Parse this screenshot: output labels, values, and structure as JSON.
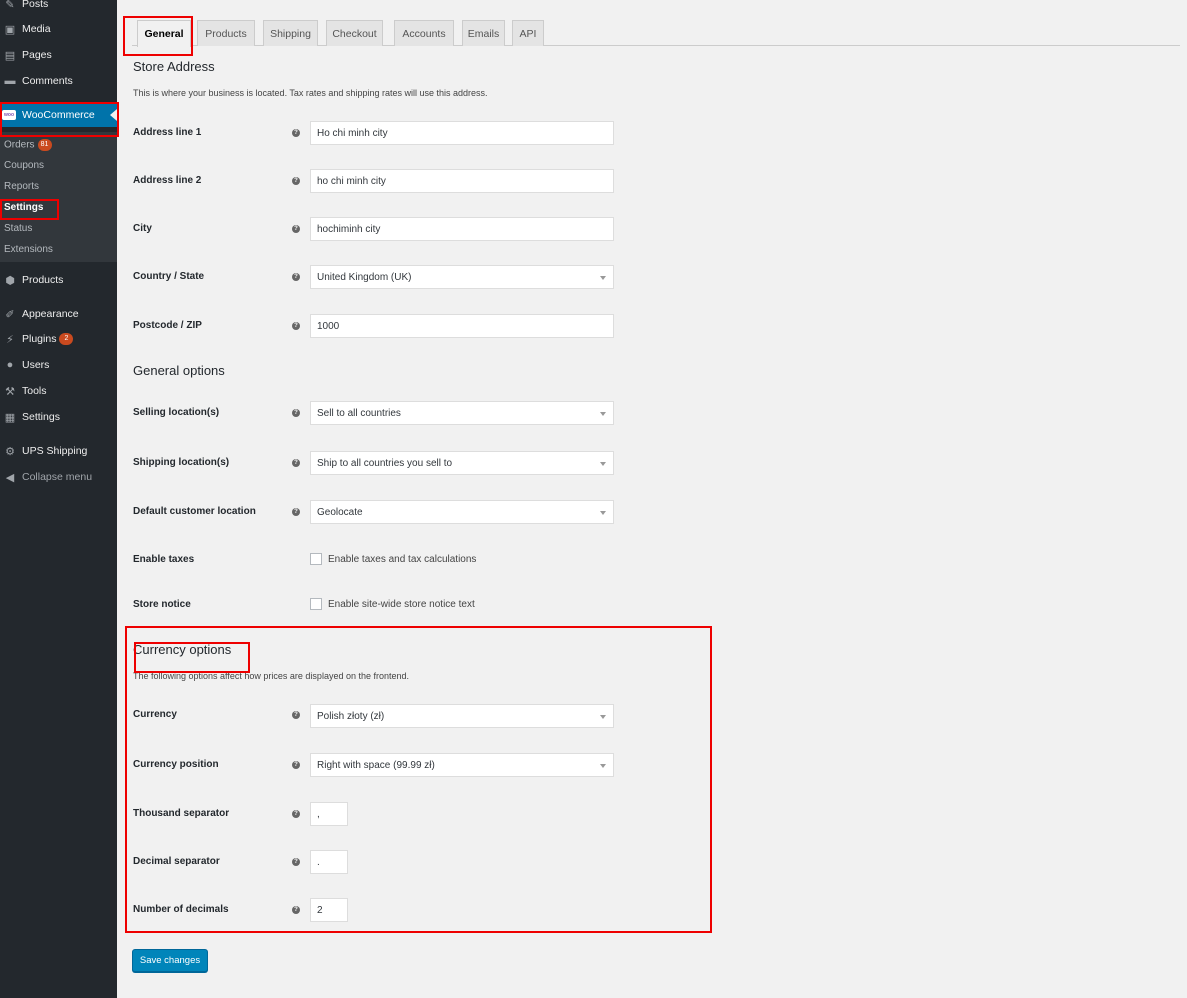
{
  "sidebar": {
    "items": [
      {
        "label": "Posts",
        "icon": "pin-icon"
      },
      {
        "label": "Media",
        "icon": "media-icon"
      },
      {
        "label": "Pages",
        "icon": "pages-icon"
      },
      {
        "label": "Comments",
        "icon": "comments-icon"
      },
      {
        "label": "WooCommerce",
        "icon": "woocommerce-icon",
        "logo_text": "woo"
      },
      {
        "label": "Products",
        "icon": "products-icon"
      },
      {
        "label": "Appearance",
        "icon": "appearance-icon"
      },
      {
        "label": "Plugins",
        "icon": "plugins-icon",
        "badge": "2"
      },
      {
        "label": "Users",
        "icon": "users-icon"
      },
      {
        "label": "Tools",
        "icon": "tools-icon"
      },
      {
        "label": "Settings",
        "icon": "settings-icon"
      },
      {
        "label": "UPS Shipping",
        "icon": "gear-icon"
      },
      {
        "label": "Collapse menu",
        "icon": "collapse-icon"
      }
    ],
    "submenu": [
      {
        "label": "Orders",
        "badge": "81"
      },
      {
        "label": "Coupons"
      },
      {
        "label": "Reports"
      },
      {
        "label": "Settings"
      },
      {
        "label": "Status"
      },
      {
        "label": "Extensions"
      }
    ],
    "active_color": "#0073aa",
    "bg_color": "#23282d"
  },
  "tabs": [
    "General",
    "Products",
    "Shipping",
    "Checkout",
    "Accounts",
    "Emails",
    "API"
  ],
  "store_address": {
    "title": "Store Address",
    "description": "This is where your business is located. Tax rates and shipping rates will use this address.",
    "fields": [
      {
        "label": "Address line 1",
        "value": "Ho chi minh city"
      },
      {
        "label": "Address line 2",
        "value": "ho chi minh city"
      },
      {
        "label": "City",
        "value": "hochiminh city"
      },
      {
        "label": "Country / State",
        "value": "United Kingdom (UK)"
      },
      {
        "label": "Postcode / ZIP",
        "value": "1000"
      }
    ]
  },
  "general_options": {
    "title": "General options",
    "fields": [
      {
        "label": "Selling location(s)",
        "value": "Sell to all countries"
      },
      {
        "label": "Shipping location(s)",
        "value": "Ship to all countries you sell to"
      },
      {
        "label": "Default customer location",
        "value": "Geolocate"
      }
    ],
    "checkboxes": [
      {
        "label": "Enable taxes",
        "text": "Enable taxes and tax calculations"
      },
      {
        "label": "Store notice",
        "text": "Enable site-wide store notice text"
      }
    ]
  },
  "currency_options": {
    "title": "Currency options",
    "description": "The following options affect how prices are displayed on the frontend.",
    "fields": [
      {
        "label": "Currency",
        "value": "Polish złoty (zł)"
      },
      {
        "label": "Currency position",
        "value": "Right with space (99.99 zł)"
      },
      {
        "label": "Thousand separator",
        "value": ","
      },
      {
        "label": "Decimal separator",
        "value": "."
      },
      {
        "label": "Number of decimals",
        "value": "2"
      }
    ]
  },
  "save_label": "Save changes",
  "help_glyph": "?",
  "colors": {
    "highlight": "#e00000",
    "primary_button": "#0085ba"
  }
}
